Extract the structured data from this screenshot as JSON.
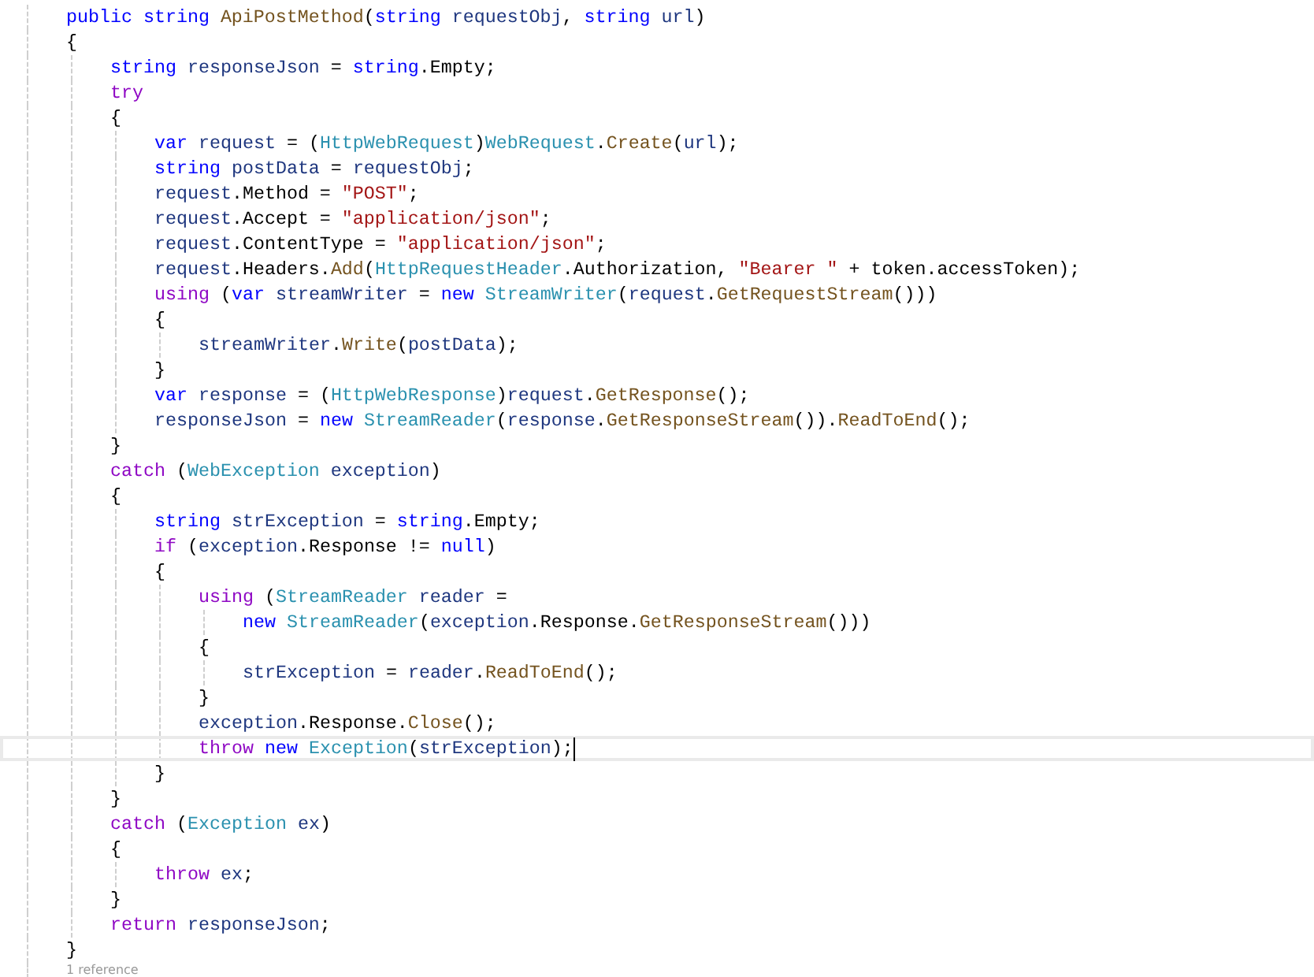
{
  "code_lines": [
    {
      "current": false,
      "tokens": [
        {
          "kind": "keyword",
          "text": "public "
        },
        {
          "kind": "keyword",
          "text": "string "
        },
        {
          "kind": "method",
          "text": "ApiPostMethod"
        },
        {
          "kind": "plain",
          "text": "("
        },
        {
          "kind": "keyword",
          "text": "string "
        },
        {
          "kind": "local",
          "text": "requestObj"
        },
        {
          "kind": "plain",
          "text": ", "
        },
        {
          "kind": "keyword",
          "text": "string "
        },
        {
          "kind": "local",
          "text": "url"
        },
        {
          "kind": "plain",
          "text": ")"
        }
      ]
    },
    {
      "current": false,
      "tokens": [
        {
          "kind": "plain",
          "text": "{"
        }
      ],
      "children": [
        {
          "current": false,
          "tokens": [
            {
              "kind": "keyword",
              "text": "string "
            },
            {
              "kind": "local",
              "text": "responseJson"
            },
            {
              "kind": "plain",
              "text": " = "
            },
            {
              "kind": "keyword",
              "text": "string"
            },
            {
              "kind": "plain",
              "text": ".Empty;"
            }
          ]
        },
        {
          "current": false,
          "tokens": [
            {
              "kind": "control",
              "text": "try"
            }
          ]
        },
        {
          "current": false,
          "tokens": [
            {
              "kind": "plain",
              "text": "{"
            }
          ],
          "children": [
            {
              "current": false,
              "tokens": [
                {
                  "kind": "keyword",
                  "text": "var "
                },
                {
                  "kind": "local",
                  "text": "request"
                },
                {
                  "kind": "plain",
                  "text": " = ("
                },
                {
                  "kind": "type",
                  "text": "HttpWebRequest"
                },
                {
                  "kind": "plain",
                  "text": ")"
                },
                {
                  "kind": "type",
                  "text": "WebRequest"
                },
                {
                  "kind": "plain",
                  "text": "."
                },
                {
                  "kind": "method",
                  "text": "Create"
                },
                {
                  "kind": "plain",
                  "text": "("
                },
                {
                  "kind": "local",
                  "text": "url"
                },
                {
                  "kind": "plain",
                  "text": ");"
                }
              ]
            },
            {
              "current": false,
              "tokens": [
                {
                  "kind": "keyword",
                  "text": "string "
                },
                {
                  "kind": "local",
                  "text": "postData"
                },
                {
                  "kind": "plain",
                  "text": " = "
                },
                {
                  "kind": "local",
                  "text": "requestObj"
                },
                {
                  "kind": "plain",
                  "text": ";"
                }
              ]
            },
            {
              "current": false,
              "tokens": [
                {
                  "kind": "local",
                  "text": "request"
                },
                {
                  "kind": "plain",
                  "text": ".Method = "
                },
                {
                  "kind": "string",
                  "text": "\"POST\""
                },
                {
                  "kind": "plain",
                  "text": ";"
                }
              ]
            },
            {
              "current": false,
              "tokens": [
                {
                  "kind": "local",
                  "text": "request"
                },
                {
                  "kind": "plain",
                  "text": ".Accept = "
                },
                {
                  "kind": "string",
                  "text": "\"application/json\""
                },
                {
                  "kind": "plain",
                  "text": ";"
                }
              ]
            },
            {
              "current": false,
              "tokens": [
                {
                  "kind": "local",
                  "text": "request"
                },
                {
                  "kind": "plain",
                  "text": ".ContentType = "
                },
                {
                  "kind": "string",
                  "text": "\"application/json\""
                },
                {
                  "kind": "plain",
                  "text": ";"
                }
              ]
            },
            {
              "current": false,
              "tokens": [
                {
                  "kind": "local",
                  "text": "request"
                },
                {
                  "kind": "plain",
                  "text": ".Headers."
                },
                {
                  "kind": "method",
                  "text": "Add"
                },
                {
                  "kind": "plain",
                  "text": "("
                },
                {
                  "kind": "type",
                  "text": "HttpRequestHeader"
                },
                {
                  "kind": "plain",
                  "text": ".Authorization, "
                },
                {
                  "kind": "string",
                  "text": "\"Bearer \""
                },
                {
                  "kind": "plain",
                  "text": " + token.accessToken);"
                }
              ]
            },
            {
              "current": false,
              "tokens": [
                {
                  "kind": "control",
                  "text": "using"
                },
                {
                  "kind": "plain",
                  "text": " ("
                },
                {
                  "kind": "keyword",
                  "text": "var "
                },
                {
                  "kind": "local",
                  "text": "streamWriter"
                },
                {
                  "kind": "plain",
                  "text": " = "
                },
                {
                  "kind": "keyword",
                  "text": "new "
                },
                {
                  "kind": "type",
                  "text": "StreamWriter"
                },
                {
                  "kind": "plain",
                  "text": "("
                },
                {
                  "kind": "local",
                  "text": "request"
                },
                {
                  "kind": "plain",
                  "text": "."
                },
                {
                  "kind": "method",
                  "text": "GetRequestStream"
                },
                {
                  "kind": "plain",
                  "text": "()))"
                }
              ]
            },
            {
              "current": false,
              "tokens": [
                {
                  "kind": "plain",
                  "text": "{"
                }
              ],
              "children": [
                {
                  "current": false,
                  "tokens": [
                    {
                      "kind": "local",
                      "text": "streamWriter"
                    },
                    {
                      "kind": "plain",
                      "text": "."
                    },
                    {
                      "kind": "method",
                      "text": "Write"
                    },
                    {
                      "kind": "plain",
                      "text": "("
                    },
                    {
                      "kind": "local",
                      "text": "postData"
                    },
                    {
                      "kind": "plain",
                      "text": ");"
                    }
                  ]
                }
              ]
            },
            {
              "current": false,
              "tokens": [
                {
                  "kind": "plain",
                  "text": "}"
                }
              ]
            },
            {
              "current": false,
              "tokens": [
                {
                  "kind": "keyword",
                  "text": "var "
                },
                {
                  "kind": "local",
                  "text": "response"
                },
                {
                  "kind": "plain",
                  "text": " = ("
                },
                {
                  "kind": "type",
                  "text": "HttpWebResponse"
                },
                {
                  "kind": "plain",
                  "text": ")"
                },
                {
                  "kind": "local",
                  "text": "request"
                },
                {
                  "kind": "plain",
                  "text": "."
                },
                {
                  "kind": "method",
                  "text": "GetResponse"
                },
                {
                  "kind": "plain",
                  "text": "();"
                }
              ]
            },
            {
              "current": false,
              "tokens": [
                {
                  "kind": "local",
                  "text": "responseJson"
                },
                {
                  "kind": "plain",
                  "text": " = "
                },
                {
                  "kind": "keyword",
                  "text": "new "
                },
                {
                  "kind": "type",
                  "text": "StreamReader"
                },
                {
                  "kind": "plain",
                  "text": "("
                },
                {
                  "kind": "local",
                  "text": "response"
                },
                {
                  "kind": "plain",
                  "text": "."
                },
                {
                  "kind": "method",
                  "text": "GetResponseStream"
                },
                {
                  "kind": "plain",
                  "text": "())."
                },
                {
                  "kind": "method",
                  "text": "ReadToEnd"
                },
                {
                  "kind": "plain",
                  "text": "();"
                }
              ]
            }
          ]
        },
        {
          "current": false,
          "tokens": [
            {
              "kind": "plain",
              "text": "}"
            }
          ]
        },
        {
          "current": false,
          "tokens": [
            {
              "kind": "control",
              "text": "catch"
            },
            {
              "kind": "plain",
              "text": " ("
            },
            {
              "kind": "type",
              "text": "WebException"
            },
            {
              "kind": "local",
              "text": " exception"
            },
            {
              "kind": "plain",
              "text": ")"
            }
          ]
        },
        {
          "current": false,
          "tokens": [
            {
              "kind": "plain",
              "text": "{"
            }
          ],
          "children": [
            {
              "current": false,
              "tokens": [
                {
                  "kind": "keyword",
                  "text": "string "
                },
                {
                  "kind": "local",
                  "text": "strException"
                },
                {
                  "kind": "plain",
                  "text": " = "
                },
                {
                  "kind": "keyword",
                  "text": "string"
                },
                {
                  "kind": "plain",
                  "text": ".Empty;"
                }
              ]
            },
            {
              "current": false,
              "tokens": [
                {
                  "kind": "control",
                  "text": "if"
                },
                {
                  "kind": "plain",
                  "text": " ("
                },
                {
                  "kind": "local",
                  "text": "exception"
                },
                {
                  "kind": "plain",
                  "text": ".Response != "
                },
                {
                  "kind": "keyword",
                  "text": "null"
                },
                {
                  "kind": "plain",
                  "text": ")"
                }
              ]
            },
            {
              "current": false,
              "tokens": [
                {
                  "kind": "plain",
                  "text": "{"
                }
              ],
              "children": [
                {
                  "current": false,
                  "tokens": [
                    {
                      "kind": "control",
                      "text": "using"
                    },
                    {
                      "kind": "plain",
                      "text": " ("
                    },
                    {
                      "kind": "type",
                      "text": "StreamReader"
                    },
                    {
                      "kind": "local",
                      "text": " reader"
                    },
                    {
                      "kind": "plain",
                      "text": " ="
                    }
                  ],
                  "children": [
                    {
                      "current": false,
                      "tokens": [
                        {
                          "kind": "keyword",
                          "text": "new "
                        },
                        {
                          "kind": "type",
                          "text": "StreamReader"
                        },
                        {
                          "kind": "plain",
                          "text": "("
                        },
                        {
                          "kind": "local",
                          "text": "exception"
                        },
                        {
                          "kind": "plain",
                          "text": ".Response."
                        },
                        {
                          "kind": "method",
                          "text": "GetResponseStream"
                        },
                        {
                          "kind": "plain",
                          "text": "()))"
                        }
                      ]
                    }
                  ]
                },
                {
                  "current": false,
                  "tokens": [
                    {
                      "kind": "plain",
                      "text": "{"
                    }
                  ],
                  "children": [
                    {
                      "current": false,
                      "tokens": [
                        {
                          "kind": "local",
                          "text": "strException"
                        },
                        {
                          "kind": "plain",
                          "text": " = "
                        },
                        {
                          "kind": "local",
                          "text": "reader"
                        },
                        {
                          "kind": "plain",
                          "text": "."
                        },
                        {
                          "kind": "method",
                          "text": "ReadToEnd"
                        },
                        {
                          "kind": "plain",
                          "text": "();"
                        }
                      ]
                    }
                  ]
                },
                {
                  "current": false,
                  "tokens": [
                    {
                      "kind": "plain",
                      "text": "}"
                    }
                  ]
                },
                {
                  "current": false,
                  "tokens": [
                    {
                      "kind": "local",
                      "text": "exception"
                    },
                    {
                      "kind": "plain",
                      "text": ".Response."
                    },
                    {
                      "kind": "method",
                      "text": "Close"
                    },
                    {
                      "kind": "plain",
                      "text": "();"
                    }
                  ]
                },
                {
                  "current": true,
                  "tokens": [
                    {
                      "kind": "control",
                      "text": "throw "
                    },
                    {
                      "kind": "keyword",
                      "text": "new "
                    },
                    {
                      "kind": "type",
                      "text": "Exception"
                    },
                    {
                      "kind": "plain",
                      "text": "("
                    },
                    {
                      "kind": "local",
                      "text": "strException"
                    },
                    {
                      "kind": "plain",
                      "text": ");"
                    }
                  ]
                }
              ]
            },
            {
              "current": false,
              "tokens": [
                {
                  "kind": "plain",
                  "text": "}"
                }
              ]
            }
          ]
        },
        {
          "current": false,
          "tokens": [
            {
              "kind": "plain",
              "text": "}"
            }
          ]
        },
        {
          "current": false,
          "tokens": [
            {
              "kind": "control",
              "text": "catch"
            },
            {
              "kind": "plain",
              "text": " ("
            },
            {
              "kind": "type",
              "text": "Exception"
            },
            {
              "kind": "local",
              "text": " ex"
            },
            {
              "kind": "plain",
              "text": ")"
            }
          ]
        },
        {
          "current": false,
          "tokens": [
            {
              "kind": "plain",
              "text": "{"
            }
          ],
          "children": [
            {
              "current": false,
              "tokens": [
                {
                  "kind": "control",
                  "text": "throw "
                },
                {
                  "kind": "local",
                  "text": "ex"
                },
                {
                  "kind": "plain",
                  "text": ";"
                }
              ]
            }
          ]
        },
        {
          "current": false,
          "tokens": [
            {
              "kind": "plain",
              "text": "}"
            }
          ]
        },
        {
          "current": false,
          "tokens": [
            {
              "kind": "control",
              "text": "return "
            },
            {
              "kind": "local",
              "text": "responseJson"
            },
            {
              "kind": "plain",
              "text": ";"
            }
          ]
        }
      ]
    },
    {
      "current": false,
      "tokens": [
        {
          "kind": "plain",
          "text": "}"
        }
      ]
    }
  ],
  "code_lens": "1 reference"
}
